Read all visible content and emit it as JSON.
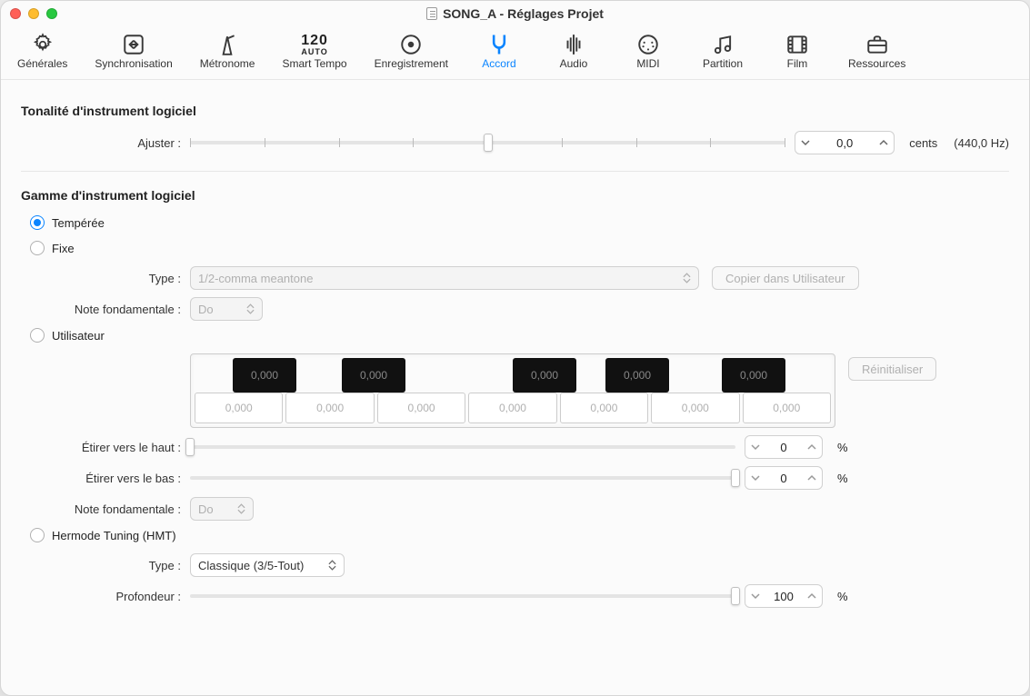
{
  "window": {
    "title": "SONG_A - Réglages Projet"
  },
  "toolbar": {
    "items": [
      {
        "label": "Générales"
      },
      {
        "label": "Synchronisation"
      },
      {
        "label": "Métronome"
      },
      {
        "label": "Smart Tempo",
        "big": "120",
        "small": "AUTO"
      },
      {
        "label": "Enregistrement"
      },
      {
        "label": "Accord"
      },
      {
        "label": "Audio"
      },
      {
        "label": "MIDI"
      },
      {
        "label": "Partition"
      },
      {
        "label": "Film"
      },
      {
        "label": "Ressources"
      }
    ],
    "active_index": 5
  },
  "section_tonality": {
    "header": "Tonalité d'instrument logiciel",
    "adjust_label": "Ajuster :",
    "adjust_value": "0,0",
    "adjust_unit": "cents",
    "adjust_hz": "(440,0 Hz)",
    "adjust_knob_pct": 50
  },
  "section_scale": {
    "header": "Gamme d'instrument logiciel",
    "radios": {
      "tempered": "Tempérée",
      "fixed": "Fixe",
      "user": "Utilisateur",
      "hmt": "Hermode Tuning (HMT)"
    },
    "type_label": "Type :",
    "type_value": "1/2-comma meantone",
    "copy_user_btn": "Copier dans Utilisateur",
    "root_label": "Note fondamentale :",
    "root_value": "Do",
    "root2_value": "Do",
    "reset_btn": "Réinitialiser",
    "black_keys": [
      "0,000",
      "0,000",
      "0,000",
      "0,000",
      "0,000"
    ],
    "white_keys": [
      "0,000",
      "0,000",
      "0,000",
      "0,000",
      "0,000",
      "0,000",
      "0,000"
    ],
    "stretch_up_label": "Étirer vers le haut :",
    "stretch_up_value": "0",
    "stretch_up_knob_pct": 0,
    "stretch_down_label": "Étirer vers le bas :",
    "stretch_down_value": "0",
    "stretch_down_knob_pct": 100,
    "pct_unit": "%",
    "hmt_type_label": "Type :",
    "hmt_type_value": "Classique (3/5-Tout)",
    "depth_label": "Profondeur :",
    "depth_value": "100",
    "depth_knob_pct": 100
  }
}
